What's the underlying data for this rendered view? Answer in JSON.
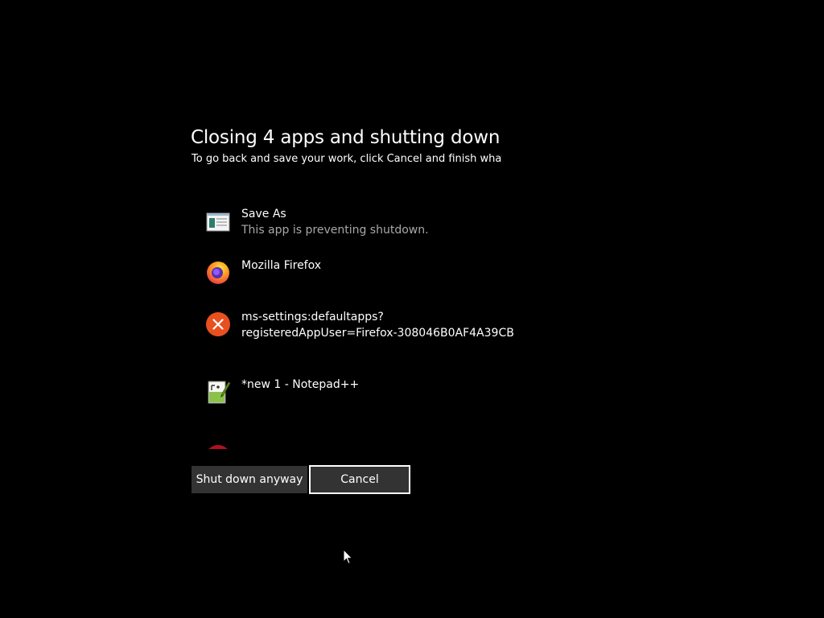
{
  "header": {
    "title": "Closing 4 apps and shutting down",
    "subtitle": "To go back and save your work, click Cancel and finish what yo"
  },
  "apps": [
    {
      "name": "Save As",
      "status": "This app is preventing shutdown.",
      "icon": "save-as-window-icon"
    },
    {
      "name": "Mozilla Firefox",
      "status": "",
      "icon": "firefox-icon"
    },
    {
      "name_line1": "ms-settings:defaultapps?",
      "name_line2": "registeredAppUser=Firefox-308046B0AF4A39CB",
      "icon": "error-x-icon"
    },
    {
      "name": "*new 1 - Notepad++",
      "status": "",
      "icon": "notepad-plus-plus-icon"
    }
  ],
  "buttons": {
    "shutdown_label": "Shut down anyway",
    "cancel_label": "Cancel"
  },
  "colors": {
    "background": "#000000",
    "button": "#333333",
    "status_text": "#a8a8a8",
    "error_icon": "#e8501f"
  }
}
